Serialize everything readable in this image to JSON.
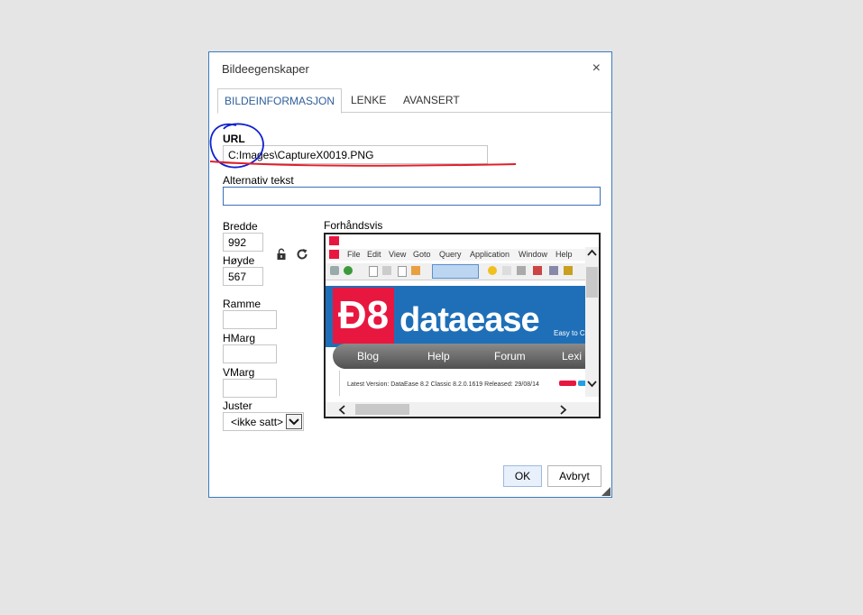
{
  "dialog": {
    "title": "Bildeegenskaper",
    "close_glyph": "×",
    "tabs": [
      {
        "label": "BILDEINFORMASJON",
        "active": true
      },
      {
        "label": "LENKE",
        "active": false
      },
      {
        "label": "AVANSERT",
        "active": false
      }
    ],
    "url": {
      "label": "URL",
      "value": "C:Images\\CaptureX0019.PNG"
    },
    "alt_text": {
      "label": "Alternativ tekst",
      "value": ""
    },
    "width": {
      "label": "Bredde",
      "value": "992"
    },
    "height": {
      "label": "Høyde",
      "value": "567"
    },
    "border": {
      "label": "Ramme",
      "value": ""
    },
    "hspace": {
      "label": "HMarg",
      "value": ""
    },
    "vspace": {
      "label": "VMarg",
      "value": ""
    },
    "align": {
      "label": "Juster",
      "value": "<ikke satt>"
    },
    "preview": {
      "label": "Forhåndsvis",
      "app_menu": [
        "File",
        "Edit",
        "View",
        "Goto",
        "Query",
        "Application",
        "Window",
        "Help"
      ],
      "logo_text": "Ð8",
      "brand": "dataease",
      "tagline": "Easy to C",
      "nav": [
        "Blog",
        "Help",
        "Forum",
        "Lexi"
      ],
      "version_text": "Latest Version: DataEase 8.2 Classic 8.2.0.1619 Released: 29/08/14"
    },
    "ok_label": "OK",
    "cancel_label": "Avbryt"
  },
  "colors": {
    "accent": "#3b7bbf",
    "preview_red": "#e8173f",
    "preview_blue": "#1e6fb8",
    "annotation_circle": "#1020d0",
    "annotation_line": "#e0202a"
  }
}
